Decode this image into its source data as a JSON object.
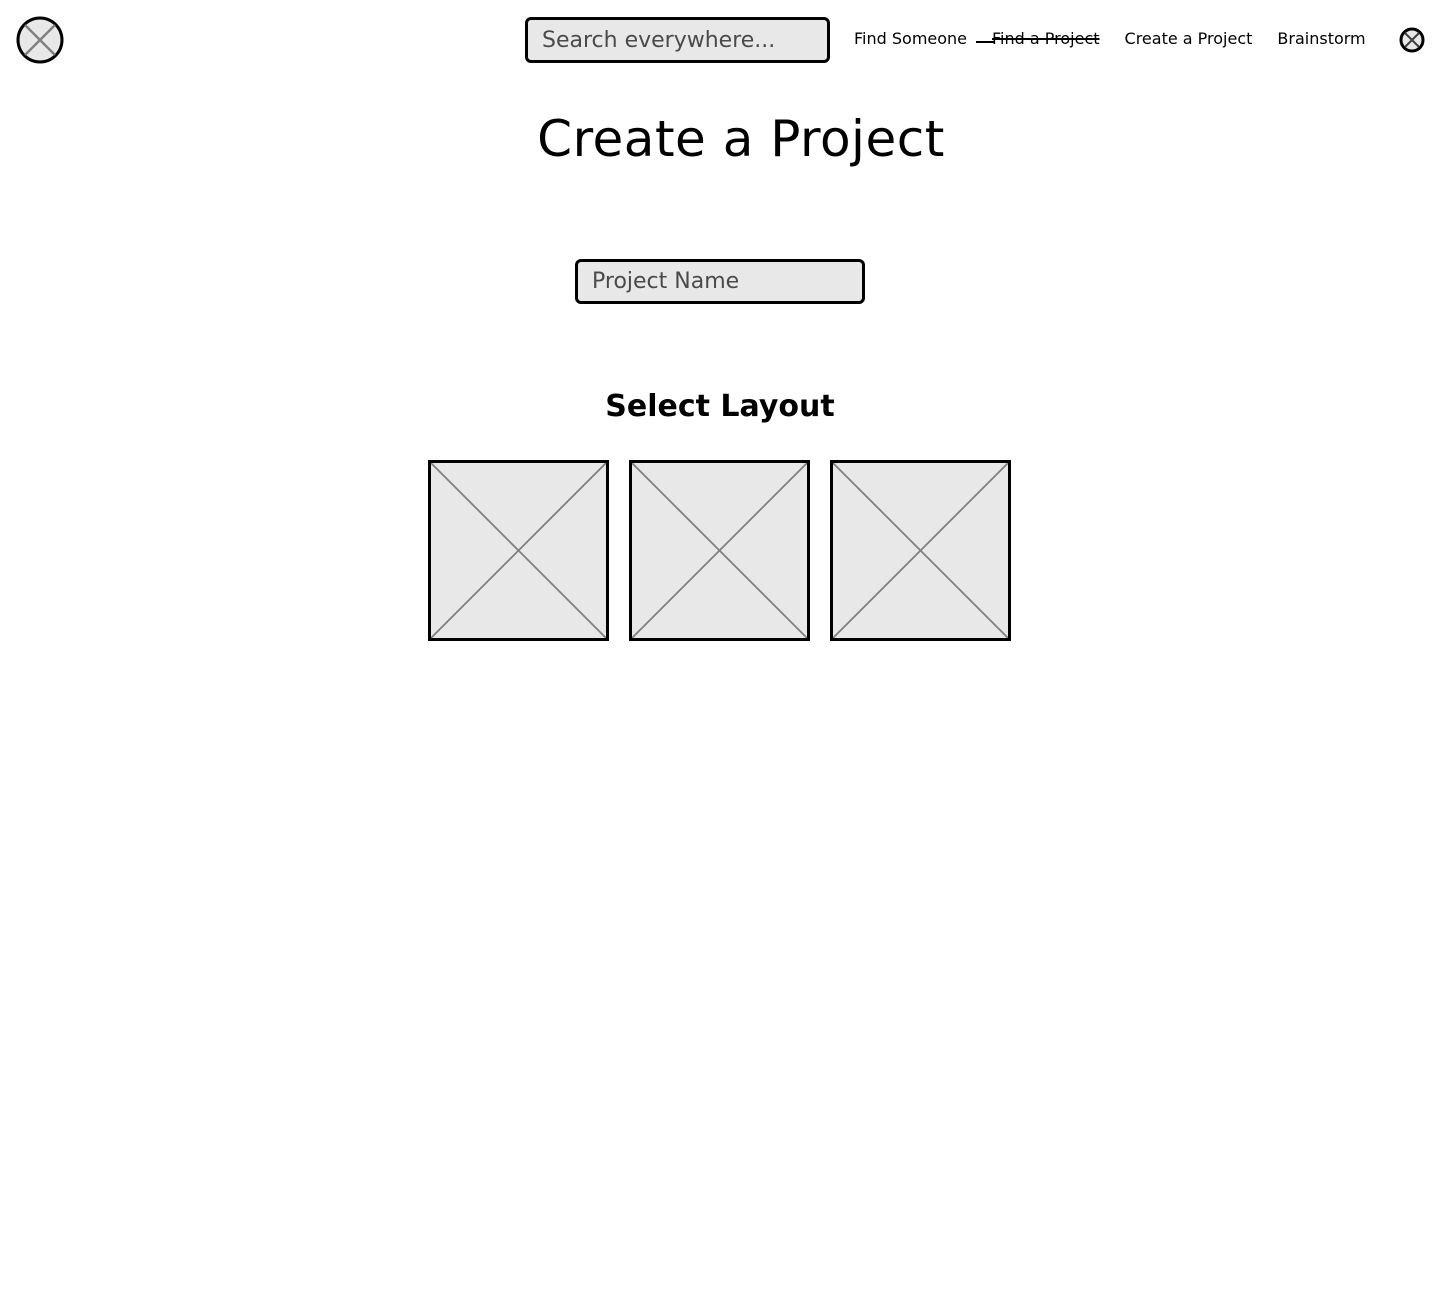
{
  "header": {
    "logo_icon": "placeholder-circle-x-icon",
    "search": {
      "placeholder": "Search everywhere...",
      "value": ""
    },
    "nav": [
      {
        "label": "Find Someone",
        "struck": false
      },
      {
        "label": "Find a Project",
        "struck": true
      },
      {
        "label": "Create a Project",
        "struck": false
      },
      {
        "label": "Brainstorm",
        "struck": false
      }
    ],
    "avatar_icon": "placeholder-circle-x-icon"
  },
  "main": {
    "title": "Create a Project",
    "project_name": {
      "placeholder": "Project Name",
      "value": ""
    },
    "layout_section": {
      "heading": "Select Layout",
      "options": [
        {
          "icon": "image-placeholder-icon"
        },
        {
          "icon": "image-placeholder-icon"
        },
        {
          "icon": "image-placeholder-icon"
        }
      ]
    }
  },
  "colors": {
    "placeholder_fill": "#e8e8e8",
    "border": "#000000",
    "cross_line": "#808080"
  }
}
